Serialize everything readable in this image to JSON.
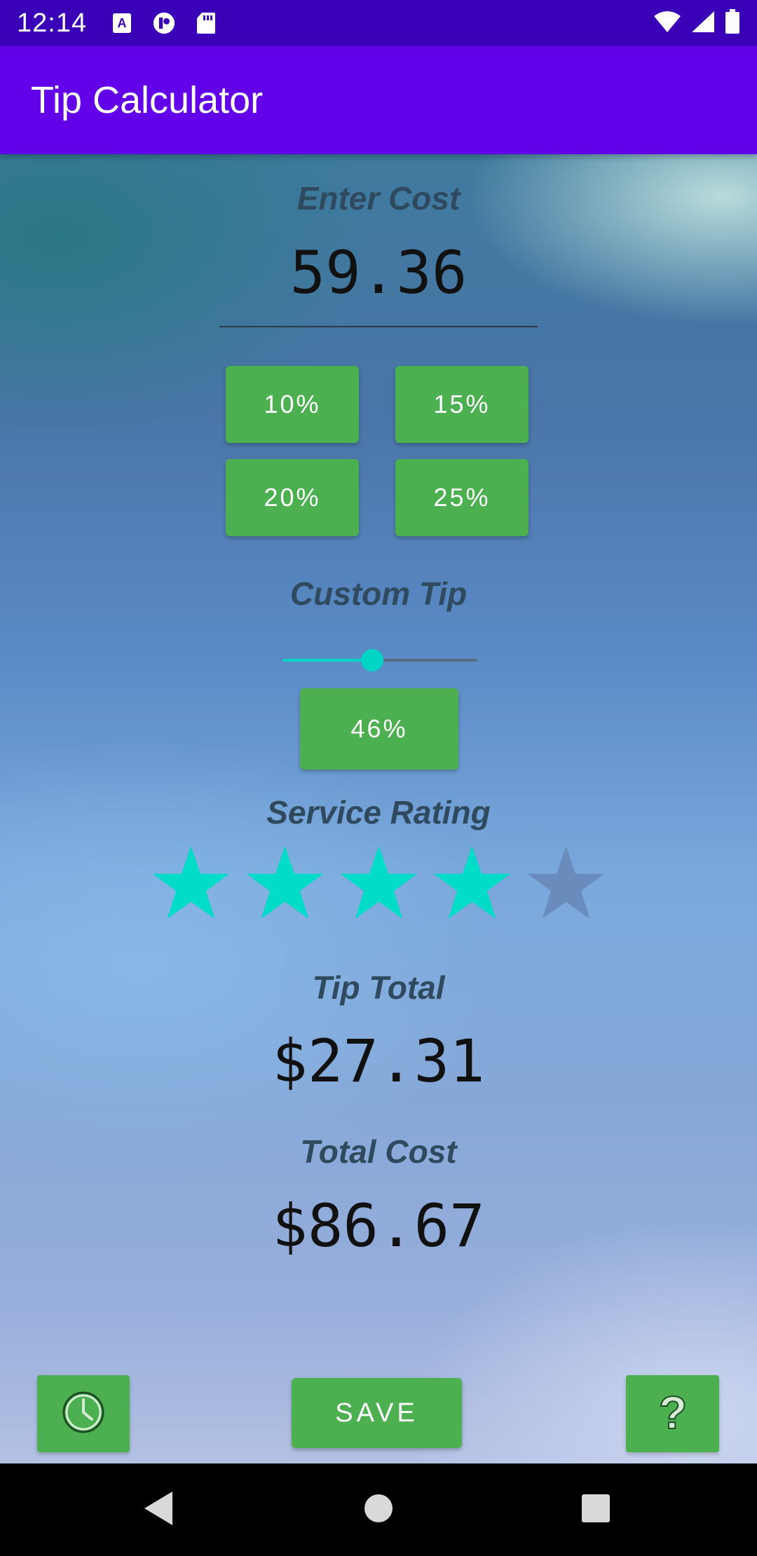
{
  "status_bar": {
    "time": "12:14",
    "left_icons": [
      "font-a-icon",
      "notification-app-icon",
      "sd-card-icon"
    ],
    "right_icons": [
      "wifi-icon",
      "signal-icon",
      "battery-icon"
    ]
  },
  "app_bar": {
    "title": "Tip Calculator"
  },
  "cost": {
    "label": "Enter Cost",
    "value": "59.36"
  },
  "preset_tips": [
    "10%",
    "15%",
    "20%",
    "25%"
  ],
  "custom_tip": {
    "label": "Custom Tip",
    "slider_fraction": 0.46,
    "value_label": "46%"
  },
  "service_rating": {
    "label": "Service Rating",
    "rating": 4,
    "max": 5
  },
  "tip_total": {
    "label": "Tip Total",
    "value": "$27.31"
  },
  "total_cost": {
    "label": "Total Cost",
    "value": "$86.67"
  },
  "actions": {
    "save_label": "SAVE",
    "history_icon": "clock-icon",
    "help_icon": "question-icon"
  },
  "colors": {
    "status_bar": "#3a00b8",
    "app_bar": "#6200ea",
    "button_green": "#4caf50",
    "star_active": "#00dcc8",
    "star_inactive": "#6a8cbd",
    "slider_accent": "#00d4c4"
  },
  "nav_bar": {
    "icons": [
      "back-icon",
      "home-icon",
      "recents-icon"
    ]
  }
}
